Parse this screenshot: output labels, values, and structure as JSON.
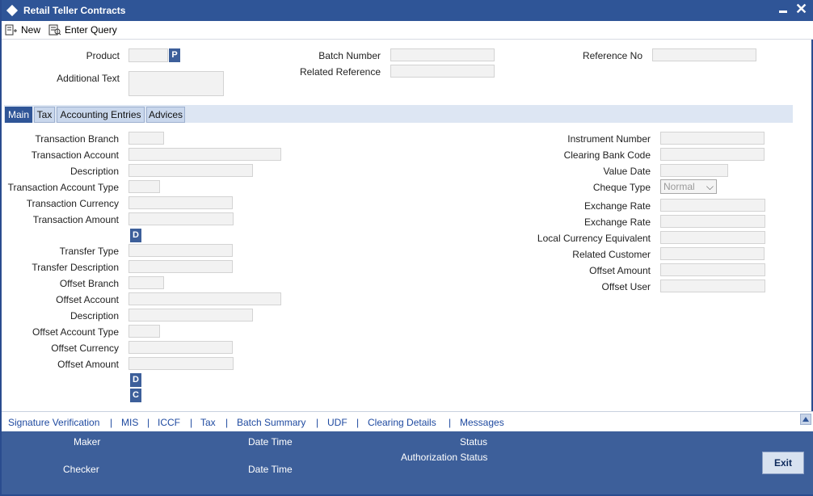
{
  "window": {
    "title": "Retail Teller Contracts"
  },
  "toolbar": {
    "new_label": "New",
    "enter_query_label": "Enter Query"
  },
  "header": {
    "product_label": "Product",
    "product_pick": "P",
    "additional_text_label": "Additional Text",
    "batch_number_label": "Batch Number",
    "related_reference_label": "Related Reference",
    "reference_no_label": "Reference No"
  },
  "tabs": [
    {
      "label": "Main"
    },
    {
      "label": "Tax"
    },
    {
      "label": "Accounting Entries"
    },
    {
      "label": "Advices"
    }
  ],
  "main_left": {
    "transaction_branch": "Transaction Branch",
    "transaction_account": "Transaction Account",
    "description": "Description",
    "transaction_account_type": "Transaction Account Type",
    "transaction_currency": "Transaction Currency",
    "transaction_amount": "Transaction Amount",
    "denomination_button_1": "D",
    "transfer_type": "Transfer Type",
    "transfer_description": "Transfer Description",
    "offset_branch": "Offset Branch",
    "offset_account": "Offset Account",
    "offset_description": "Description",
    "offset_account_type": "Offset Account Type",
    "offset_currency": "Offset Currency",
    "offset_amount": "Offset Amount",
    "denomination_button_2": "D",
    "charges_button": "C"
  },
  "main_right": {
    "instrument_number": "Instrument Number",
    "clearing_bank_code": "Clearing Bank Code",
    "value_date": "Value Date",
    "cheque_type": "Cheque Type",
    "cheque_type_value": "Normal",
    "exchange_rate_1": "Exchange Rate",
    "exchange_rate_2": "Exchange Rate",
    "local_currency_equivalent": "Local Currency Equivalent",
    "related_customer": "Related Customer",
    "offset_amount": "Offset Amount",
    "offset_user": "Offset User"
  },
  "links": [
    {
      "label": "Signature Verification"
    },
    {
      "label": "MIS"
    },
    {
      "label": "ICCF"
    },
    {
      "label": "Tax"
    },
    {
      "label": "Batch Summary"
    },
    {
      "label": "UDF"
    },
    {
      "label": "Clearing Details"
    },
    {
      "label": "Messages"
    }
  ],
  "link_separator": "|",
  "footer": {
    "maker": "Maker",
    "checker": "Checker",
    "date_time_1": "Date Time",
    "date_time_2": "Date Time",
    "status": "Status",
    "authorization_status": "Authorization Status",
    "exit": "Exit"
  },
  "colors": {
    "title_bar": "#2f5597",
    "footer": "#3d5f9a",
    "link": "#1f4aa0"
  }
}
